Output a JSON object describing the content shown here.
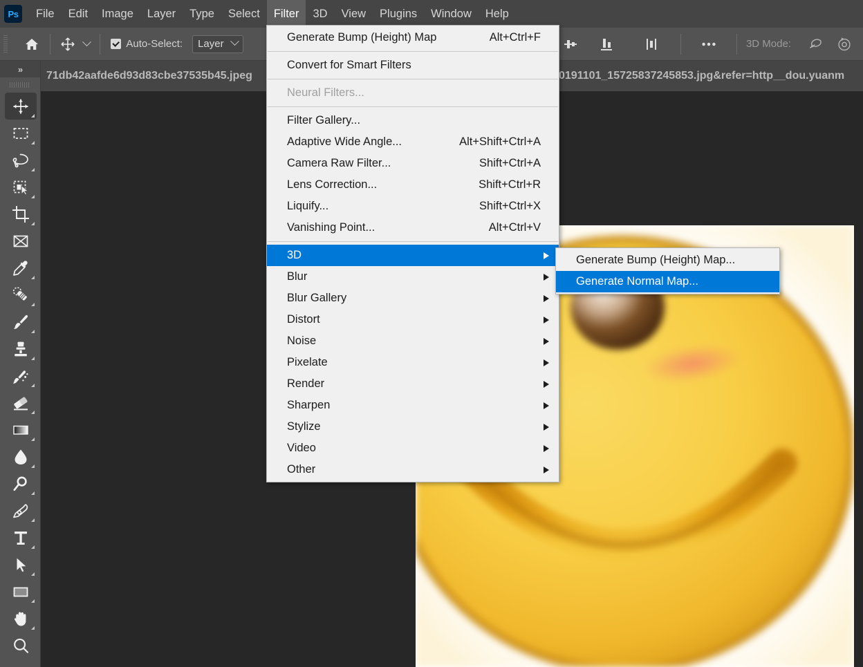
{
  "app": {
    "name": "Adobe Photoshop",
    "logo_text": "Ps",
    "accent_color": "#31a8ff",
    "menu_highlight_color": "#0078d7",
    "chrome_color": "#535353"
  },
  "menubar": {
    "items": [
      {
        "label": "File",
        "active": false
      },
      {
        "label": "Edit",
        "active": false
      },
      {
        "label": "Image",
        "active": false
      },
      {
        "label": "Layer",
        "active": false
      },
      {
        "label": "Type",
        "active": false
      },
      {
        "label": "Select",
        "active": false
      },
      {
        "label": "Filter",
        "active": true
      },
      {
        "label": "3D",
        "active": false
      },
      {
        "label": "View",
        "active": false
      },
      {
        "label": "Plugins",
        "active": false
      },
      {
        "label": "Window",
        "active": false
      },
      {
        "label": "Help",
        "active": false
      }
    ]
  },
  "options_bar": {
    "home_icon": "home-icon",
    "tool_icon": "move-tool-icon",
    "tool_preset_caret": "chevron-down-icon",
    "auto_select": {
      "label": "Auto-Select:",
      "checked": true
    },
    "auto_select_scope": {
      "value": "Layer",
      "caret": "chevron-down-icon"
    },
    "align_icons": [
      "align-top-edges-icon",
      "align-vertical-centers-icon",
      "align-bottom-edges-icon",
      "distribute-horizontal-centers-icon"
    ],
    "more_icon": "ellipsis-icon",
    "mode_3d": {
      "label": "3D Mode:",
      "icons": [
        "orbit-3d-icon",
        "roll-3d-icon"
      ]
    }
  },
  "tabs": [
    {
      "label": "71db42aafde6d93d83cbe37535b45.jpeg",
      "active": false
    },
    {
      "label": "0191101_15725837245853.jpg&refer=http__dou.yuanm",
      "active": true
    }
  ],
  "toolbar": {
    "collapse_label": "»",
    "tools": [
      {
        "name": "move-tool",
        "selected": true,
        "has_flyout": true
      },
      {
        "name": "rectangular-marquee-tool",
        "selected": false,
        "has_flyout": true
      },
      {
        "name": "lasso-tool",
        "selected": false,
        "has_flyout": true
      },
      {
        "name": "object-selection-tool",
        "selected": false,
        "has_flyout": true
      },
      {
        "name": "crop-tool",
        "selected": false,
        "has_flyout": true
      },
      {
        "name": "frame-tool",
        "selected": false,
        "has_flyout": false
      },
      {
        "name": "eyedropper-tool",
        "selected": false,
        "has_flyout": true
      },
      {
        "name": "spot-healing-brush-tool",
        "selected": false,
        "has_flyout": true
      },
      {
        "name": "brush-tool",
        "selected": false,
        "has_flyout": true
      },
      {
        "name": "clone-stamp-tool",
        "selected": false,
        "has_flyout": true
      },
      {
        "name": "history-brush-tool",
        "selected": false,
        "has_flyout": true
      },
      {
        "name": "eraser-tool",
        "selected": false,
        "has_flyout": true
      },
      {
        "name": "gradient-tool",
        "selected": false,
        "has_flyout": true
      },
      {
        "name": "blur-tool",
        "selected": false,
        "has_flyout": true
      },
      {
        "name": "dodge-tool",
        "selected": false,
        "has_flyout": true
      },
      {
        "name": "pen-tool",
        "selected": false,
        "has_flyout": true
      },
      {
        "name": "horizontal-type-tool",
        "selected": false,
        "has_flyout": true
      },
      {
        "name": "path-selection-tool",
        "selected": false,
        "has_flyout": true
      },
      {
        "name": "rectangle-tool",
        "selected": false,
        "has_flyout": true
      },
      {
        "name": "hand-tool",
        "selected": false,
        "has_flyout": true
      },
      {
        "name": "zoom-tool",
        "selected": false,
        "has_flyout": false
      }
    ]
  },
  "filter_menu": {
    "items": [
      {
        "type": "item",
        "label": "Generate Bump (Height) Map",
        "accel": "Alt+Ctrl+F",
        "disabled": false,
        "submenu": false,
        "highlighted": false
      },
      {
        "type": "separator"
      },
      {
        "type": "item",
        "label": "Convert for Smart Filters",
        "accel": "",
        "disabled": false,
        "submenu": false,
        "highlighted": false
      },
      {
        "type": "separator"
      },
      {
        "type": "item",
        "label": "Neural Filters...",
        "accel": "",
        "disabled": true,
        "submenu": false,
        "highlighted": false
      },
      {
        "type": "separator"
      },
      {
        "type": "item",
        "label": "Filter Gallery...",
        "accel": "",
        "disabled": false,
        "submenu": false,
        "highlighted": false
      },
      {
        "type": "item",
        "label": "Adaptive Wide Angle...",
        "accel": "Alt+Shift+Ctrl+A",
        "disabled": false,
        "submenu": false,
        "highlighted": false
      },
      {
        "type": "item",
        "label": "Camera Raw Filter...",
        "accel": "Shift+Ctrl+A",
        "disabled": false,
        "submenu": false,
        "highlighted": false
      },
      {
        "type": "item",
        "label": "Lens Correction...",
        "accel": "Shift+Ctrl+R",
        "disabled": false,
        "submenu": false,
        "highlighted": false
      },
      {
        "type": "item",
        "label": "Liquify...",
        "accel": "Shift+Ctrl+X",
        "disabled": false,
        "submenu": false,
        "highlighted": false
      },
      {
        "type": "item",
        "label": "Vanishing Point...",
        "accel": "Alt+Ctrl+V",
        "disabled": false,
        "submenu": false,
        "highlighted": false
      },
      {
        "type": "separator"
      },
      {
        "type": "item",
        "label": "3D",
        "accel": "",
        "disabled": false,
        "submenu": true,
        "highlighted": true
      },
      {
        "type": "item",
        "label": "Blur",
        "accel": "",
        "disabled": false,
        "submenu": true,
        "highlighted": false
      },
      {
        "type": "item",
        "label": "Blur Gallery",
        "accel": "",
        "disabled": false,
        "submenu": true,
        "highlighted": false
      },
      {
        "type": "item",
        "label": "Distort",
        "accel": "",
        "disabled": false,
        "submenu": true,
        "highlighted": false
      },
      {
        "type": "item",
        "label": "Noise",
        "accel": "",
        "disabled": false,
        "submenu": true,
        "highlighted": false
      },
      {
        "type": "item",
        "label": "Pixelate",
        "accel": "",
        "disabled": false,
        "submenu": true,
        "highlighted": false
      },
      {
        "type": "item",
        "label": "Render",
        "accel": "",
        "disabled": false,
        "submenu": true,
        "highlighted": false
      },
      {
        "type": "item",
        "label": "Sharpen",
        "accel": "",
        "disabled": false,
        "submenu": true,
        "highlighted": false
      },
      {
        "type": "item",
        "label": "Stylize",
        "accel": "",
        "disabled": false,
        "submenu": true,
        "highlighted": false
      },
      {
        "type": "item",
        "label": "Video",
        "accel": "",
        "disabled": false,
        "submenu": true,
        "highlighted": false
      },
      {
        "type": "item",
        "label": "Other",
        "accel": "",
        "disabled": false,
        "submenu": true,
        "highlighted": false
      }
    ]
  },
  "filter_3d_submenu": {
    "items": [
      {
        "type": "item",
        "label": "Generate Bump (Height) Map...",
        "accel": "",
        "disabled": false,
        "submenu": false,
        "highlighted": false
      },
      {
        "type": "item",
        "label": "Generate Normal Map...",
        "accel": "",
        "disabled": false,
        "submenu": false,
        "highlighted": true
      }
    ]
  },
  "document": {
    "image_description": "blurred yellow smiley face emoji on white background",
    "background": "#ffffff"
  }
}
